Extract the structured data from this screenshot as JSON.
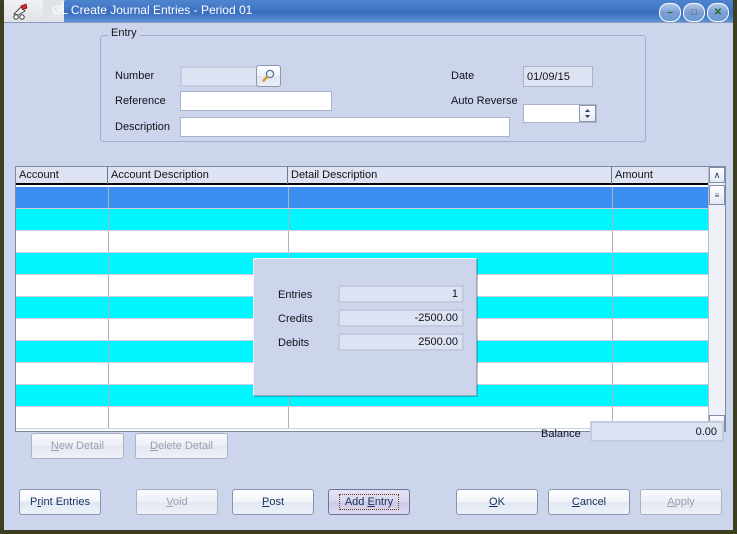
{
  "window": {
    "title": "GL Create Journal Entries - Period 01",
    "app_icon": "journal-entries-icon",
    "controls": {
      "minimize": "–",
      "maximize": "□",
      "close": "✕"
    }
  },
  "entry_group": {
    "legend": "Entry",
    "number": {
      "label": "Number",
      "value": "",
      "lookup_icon": "magnifier-icon"
    },
    "reference": {
      "label": "Reference",
      "value": ""
    },
    "description": {
      "label": "Description",
      "value": ""
    },
    "date": {
      "label": "Date",
      "value": "01/09/15"
    },
    "auto_reverse": {
      "label": "Auto Reverse",
      "value": "",
      "spinner_icon": "↕"
    }
  },
  "grid": {
    "columns": [
      {
        "label": "Account"
      },
      {
        "label": "Account Description"
      },
      {
        "label": "Detail Description"
      },
      {
        "label": "Amount"
      }
    ],
    "rows": [
      {
        "account": "",
        "account_description": "",
        "detail_description": "",
        "amount": "",
        "state": "selected"
      },
      {
        "account": "",
        "account_description": "",
        "detail_description": "",
        "amount": "",
        "state": "odd"
      },
      {
        "account": "",
        "account_description": "",
        "detail_description": "",
        "amount": "",
        "state": "even"
      },
      {
        "account": "",
        "account_description": "",
        "detail_description": "",
        "amount": "",
        "state": "odd"
      },
      {
        "account": "",
        "account_description": "",
        "detail_description": "",
        "amount": "",
        "state": "even"
      },
      {
        "account": "",
        "account_description": "",
        "detail_description": "",
        "amount": "",
        "state": "odd"
      },
      {
        "account": "",
        "account_description": "",
        "detail_description": "",
        "amount": "",
        "state": "even"
      },
      {
        "account": "",
        "account_description": "",
        "detail_description": "",
        "amount": "",
        "state": "odd"
      },
      {
        "account": "",
        "account_description": "",
        "detail_description": "",
        "amount": "",
        "state": "even"
      },
      {
        "account": "",
        "account_description": "",
        "detail_description": "",
        "amount": "",
        "state": "odd"
      },
      {
        "account": "",
        "account_description": "",
        "detail_description": "",
        "amount": "",
        "state": "even"
      }
    ],
    "scrollbar": {
      "up_arrow": "∧",
      "down_arrow": "∨",
      "thumb_grip": "≡"
    }
  },
  "summary_popup": {
    "entries": {
      "label": "Entries",
      "value": "1"
    },
    "credits": {
      "label": "Credits",
      "value": "-2500.00"
    },
    "debits": {
      "label": "Debits",
      "value": "2500.00"
    }
  },
  "balance": {
    "label": "Balance",
    "value": "0.00"
  },
  "detail_buttons": {
    "new_detail": {
      "label": "New Detail",
      "accel": "N",
      "rest": "ew Detail",
      "enabled": false
    },
    "delete_detail": {
      "label": "Delete Detail",
      "accel": "D",
      "rest": "elete Detail",
      "enabled": false
    }
  },
  "action_buttons": {
    "print_entries": {
      "label": "Print Entries",
      "pre": "P",
      "accel": "r",
      "rest": "int Entries",
      "enabled": true
    },
    "void": {
      "label": "Void",
      "accel": "V",
      "rest": "oid",
      "enabled": false
    },
    "post": {
      "label": "Post",
      "accel": "P",
      "rest": "ost",
      "enabled": true
    },
    "add_entry": {
      "label": "Add Entry",
      "pre": "Add ",
      "accel": "E",
      "rest": "ntry",
      "enabled": true,
      "focused": true
    },
    "ok": {
      "label": "OK",
      "accel": "O",
      "rest": "K",
      "enabled": true
    },
    "cancel": {
      "label": "Cancel",
      "accel": "C",
      "rest": "ancel",
      "enabled": true
    },
    "apply": {
      "label": "Apply",
      "accel": "A",
      "rest": "pply",
      "enabled": false
    }
  },
  "colors": {
    "titlebar": "#3f74c4",
    "window_face": "#ccd5ec",
    "row_alt": "#00f7ff",
    "row_selected": "#3b8ef0",
    "desktop": "#3d3f20"
  }
}
